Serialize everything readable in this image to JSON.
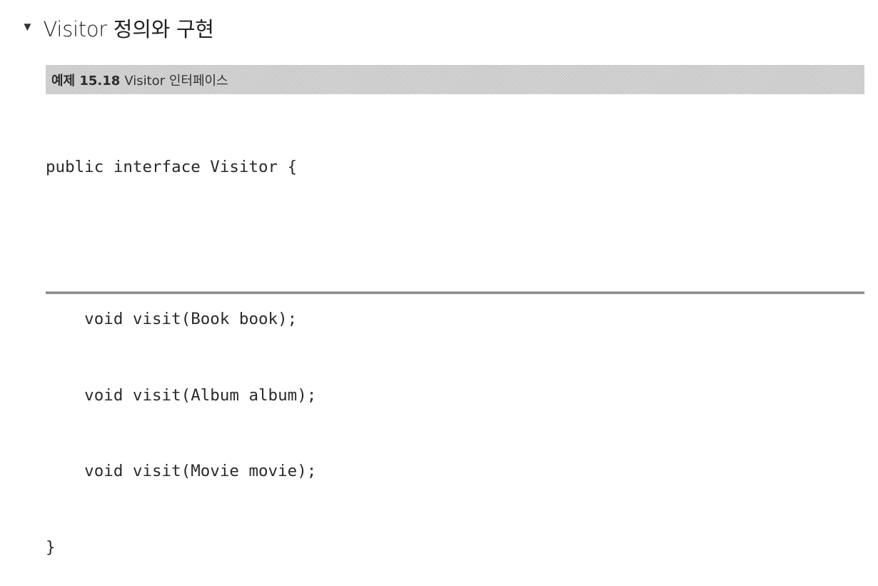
{
  "section": {
    "bullet": "▼",
    "heading": "Visitor 정의와 구현"
  },
  "example": {
    "number": "예제 15.18",
    "title": "Visitor 인터페이스"
  },
  "code": {
    "lines": [
      "public interface Visitor {",
      "",
      "    void visit(Book book);",
      "    void visit(Album album);",
      "    void visit(Movie movie);",
      "}"
    ]
  }
}
